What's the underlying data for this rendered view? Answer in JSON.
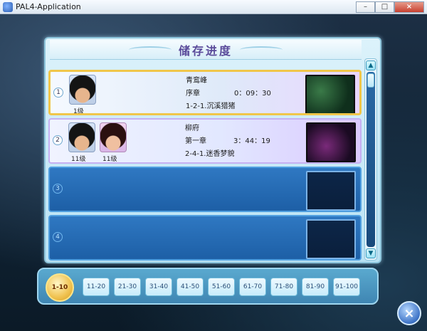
{
  "window": {
    "title": "PAL4-Application"
  },
  "save_menu": {
    "title": "储存进度",
    "slots": [
      {
        "number": "1",
        "location": "青鸾峰",
        "chapter": "序章",
        "playtime": "0：09：30",
        "objective": "1-2-1.沉溪猎猪",
        "levels": [
          "1级"
        ]
      },
      {
        "number": "2",
        "location": "柳府",
        "chapter": "第一章",
        "playtime": "3：44：19",
        "objective": "2-4-1.迷香梦貌",
        "levels": [
          "11级",
          "11级"
        ]
      },
      {
        "number": "3"
      },
      {
        "number": "4"
      }
    ]
  },
  "pagination": {
    "active": "1-10",
    "pages": [
      "11-20",
      "21-30",
      "31-40",
      "41-50",
      "51-60",
      "61-70",
      "71-80",
      "81-90",
      "91-100"
    ]
  },
  "buttons": {
    "scroll_up": "▲",
    "scroll_down": "▼",
    "close": "×",
    "minimize": "–",
    "maximize": "□",
    "win_close": "×"
  }
}
